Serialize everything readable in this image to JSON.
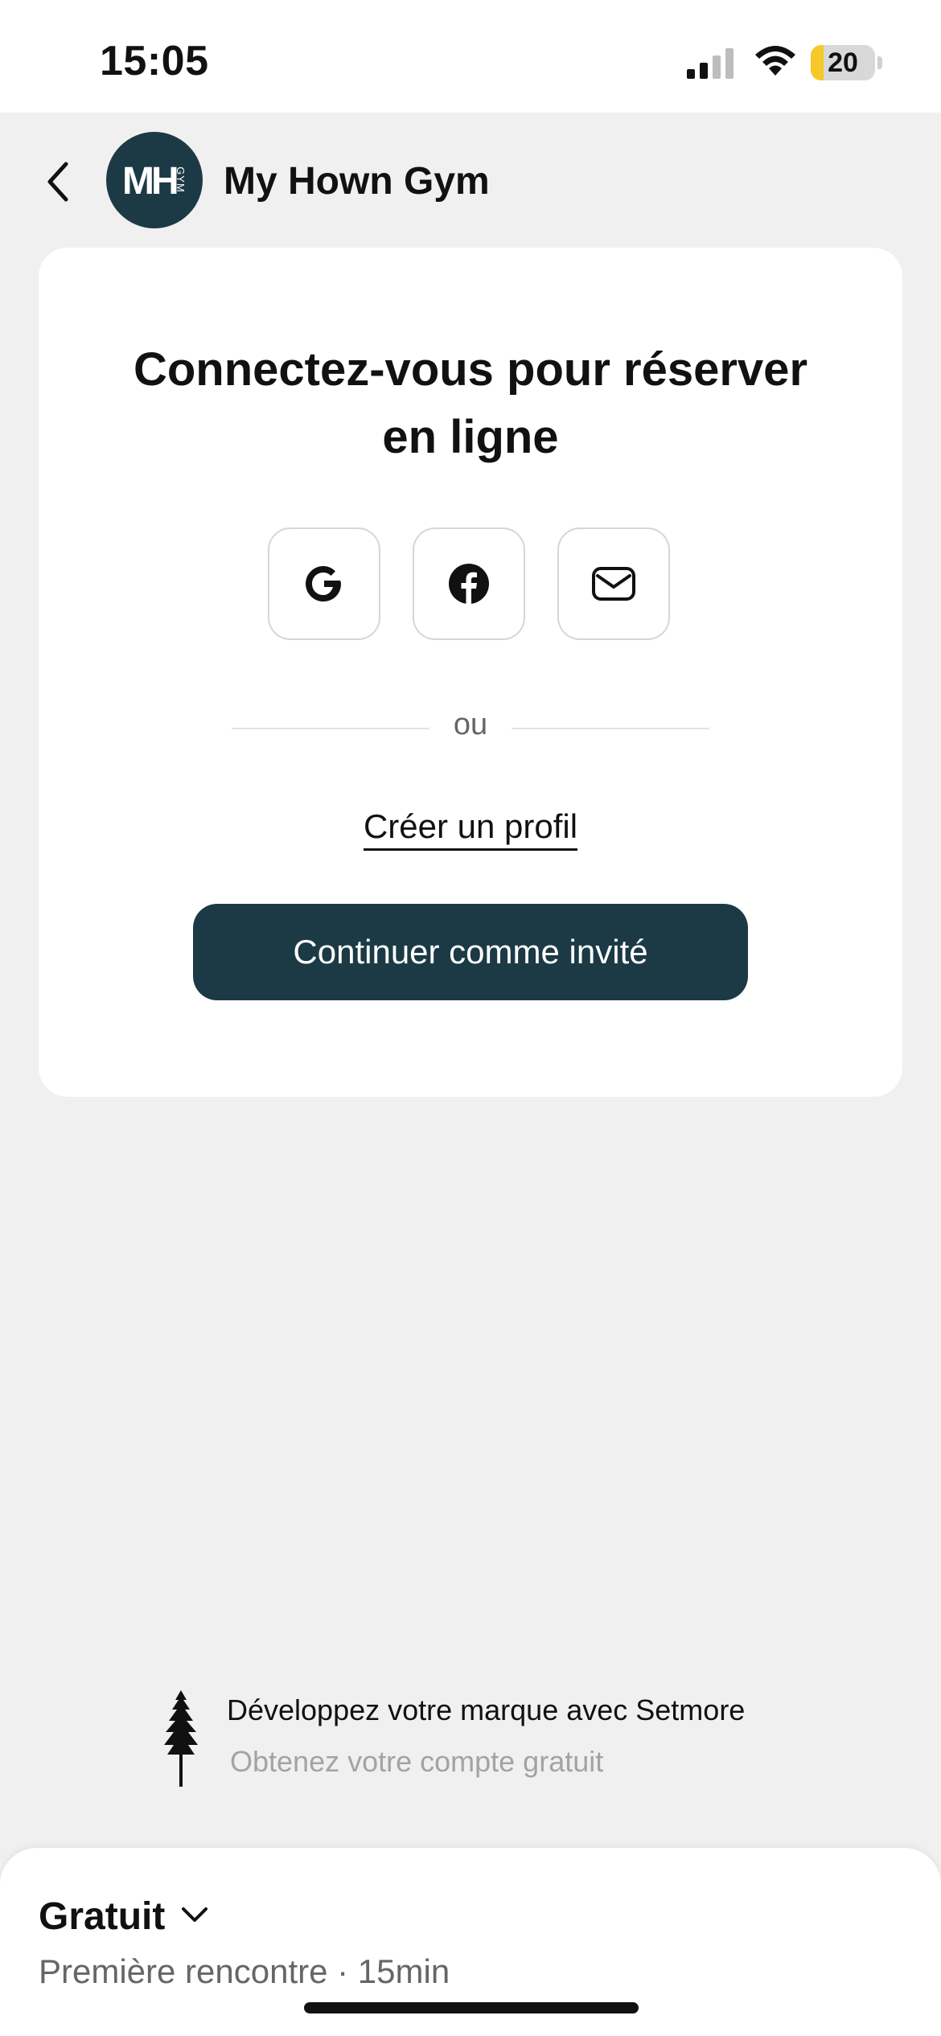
{
  "status_bar": {
    "time": "15:05",
    "battery_level": "20",
    "battery_fill_fraction": 0.2,
    "battery_color": "#f5c928"
  },
  "header": {
    "back_icon": "chevron-left-icon",
    "avatar_letters": "MH",
    "avatar_sub": "GYM",
    "business_name": "My Hown Gym",
    "avatar_color": "#1c3a46"
  },
  "login_card": {
    "title": "Connectez-vous pour réserver en ligne",
    "social_buttons": [
      {
        "icon": "google-icon"
      },
      {
        "icon": "facebook-icon"
      },
      {
        "icon": "mail-icon"
      }
    ],
    "divider_text": "ou",
    "create_profile_label": "Créer un profil",
    "guest_button_label": "Continuer comme invité",
    "guest_button_color": "#1b3a45"
  },
  "promo": {
    "icon": "tree-icon",
    "line1": "Développez votre marque avec Setmore",
    "line2": "Obtenez votre compte gratuit"
  },
  "bottom_sheet": {
    "plan_label": "Gratuit",
    "chevron_icon": "chevron-down-icon",
    "service_info": "Première rencontre · 15min"
  }
}
